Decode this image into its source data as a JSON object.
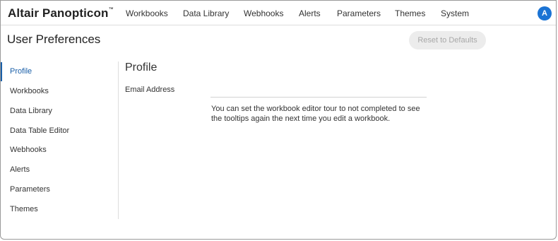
{
  "brand": {
    "name": "Altair Panopticon",
    "trademark": "™"
  },
  "nav": {
    "items": [
      {
        "label": "Workbooks"
      },
      {
        "label": "Data Library"
      },
      {
        "label": "Webhooks"
      },
      {
        "label": "Alerts"
      },
      {
        "label": "Parameters"
      },
      {
        "label": "Themes"
      },
      {
        "label": "System"
      }
    ]
  },
  "user": {
    "avatar_initial": "A",
    "avatar_color": "#1a73d4"
  },
  "header": {
    "title": "User Preferences",
    "reset_label": "Reset to Defaults"
  },
  "sidebar": {
    "active_index": 0,
    "accent_color": "#1a5fa8",
    "items": [
      {
        "label": "Profile"
      },
      {
        "label": "Workbooks"
      },
      {
        "label": "Data Library"
      },
      {
        "label": "Data Table Editor"
      },
      {
        "label": "Webhooks"
      },
      {
        "label": "Alerts"
      },
      {
        "label": "Parameters"
      },
      {
        "label": "Themes"
      }
    ]
  },
  "main": {
    "section_title": "Profile",
    "email_label": "Email Address",
    "email_value": "",
    "note_line1": "You can set the workbook editor tour to not completed to see",
    "note_line2": "the tooltips again the next time you edit a workbook."
  }
}
